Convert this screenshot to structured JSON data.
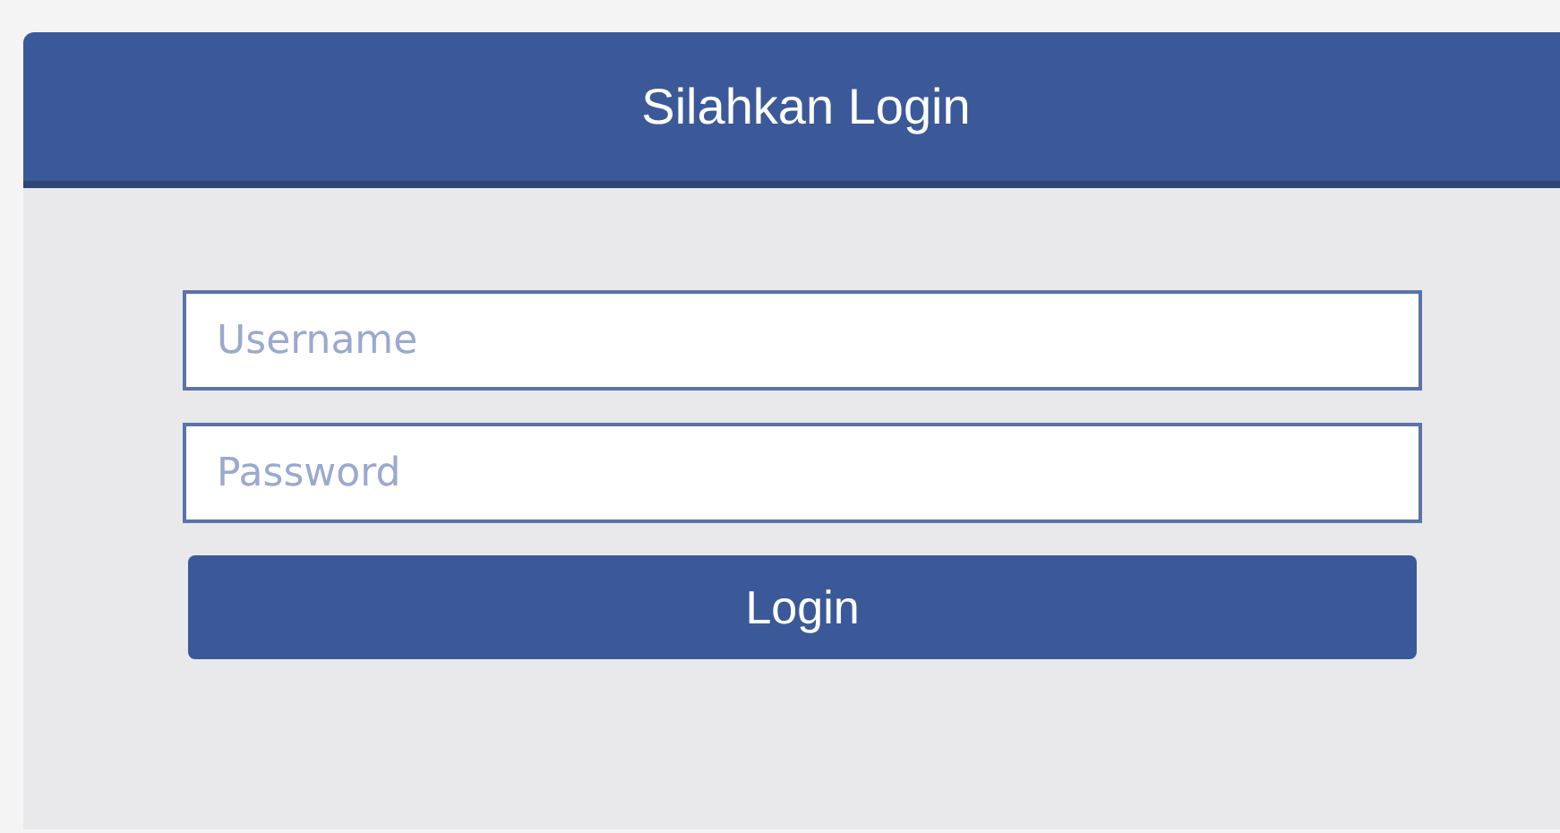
{
  "header": {
    "title": "Silahkan Login"
  },
  "fields": [
    {
      "placeholder": "Username"
    },
    {
      "placeholder": "Password"
    }
  ],
  "button": {
    "label": "Login"
  }
}
